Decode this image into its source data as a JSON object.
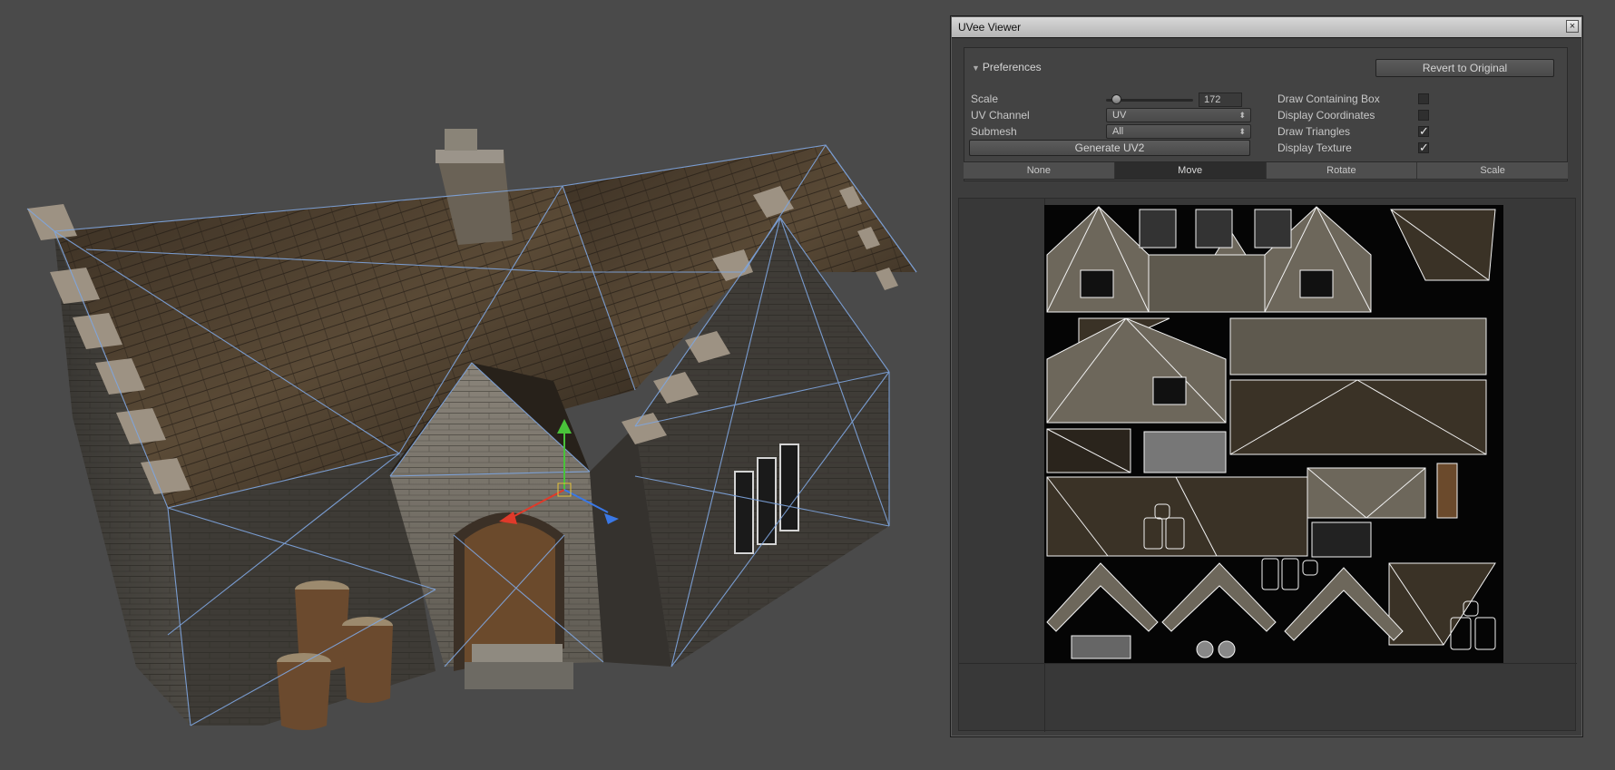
{
  "window": {
    "title": "UVee Viewer",
    "close_glyph": "×"
  },
  "preferences": {
    "foldout_label": "Preferences",
    "revert_button": "Revert to Original",
    "scale_label": "Scale",
    "scale_value": "172",
    "uv_channel_label": "UV Channel",
    "uv_channel_value": "UV",
    "submesh_label": "Submesh",
    "submesh_value": "All",
    "generate_uv2_button": "Generate UV2",
    "draw_containing_box_label": "Draw Containing Box",
    "draw_containing_box_checked": false,
    "display_coordinates_label": "Display Coordinates",
    "display_coordinates_checked": false,
    "draw_triangles_label": "Draw Triangles",
    "draw_triangles_checked": true,
    "display_texture_label": "Display Texture",
    "display_texture_checked": true
  },
  "toolbar": {
    "none": "None",
    "move": "Move",
    "rotate": "Rotate",
    "scale": "Scale",
    "active": "Move"
  },
  "colors": {
    "viewport_bg": "#4a4a4a",
    "wireframe": "#7fa6e0",
    "uv_lines": "#f2f2f2",
    "gizmo_x": "#e03a2a",
    "gizmo_y": "#49c23a",
    "gizmo_z": "#3a78e6"
  },
  "icons": {
    "close": "close-icon",
    "foldout": "foldout-arrow-icon",
    "popup": "updown-arrow-icon",
    "check": "checkmark-icon"
  }
}
